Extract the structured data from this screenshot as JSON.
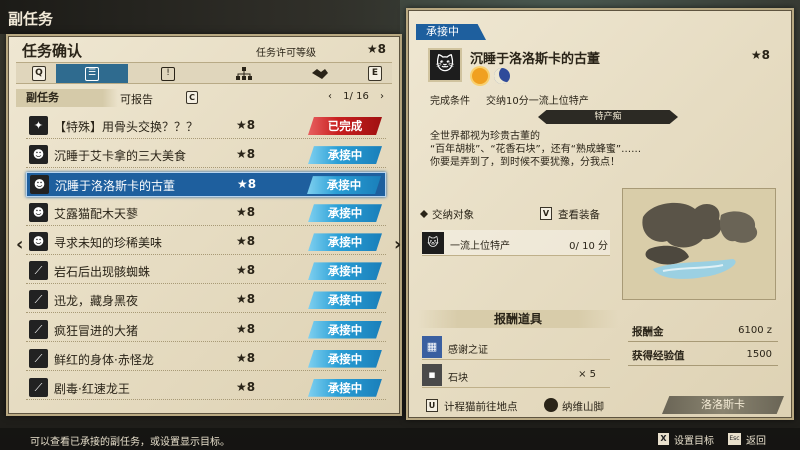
{
  "header": {
    "title": "副任务"
  },
  "left": {
    "title": "任务确认",
    "permit_label": "任务许可等级",
    "permit_level": "★8",
    "tabs": {
      "prev_key": "Q",
      "next_key": "E"
    },
    "filter": {
      "sub_label": "副任务",
      "report_label": "可报告",
      "report_key": "C",
      "prev": "‹",
      "page": "1/ 16",
      "next": "›"
    },
    "nav": {
      "left": "‹",
      "right": "›"
    },
    "quests": [
      {
        "icon": "bone-icon",
        "name": "【特殊】用骨头交换？？？",
        "star": "★8",
        "status": "已完成",
        "type": "done"
      },
      {
        "icon": "cat-icon",
        "name": "沉睡于艾卡拿的三大美食",
        "star": "★8",
        "status": "承接中",
        "type": "accept"
      },
      {
        "icon": "cat-icon",
        "name": "沉睡于洛洛斯卡的古董",
        "star": "★8",
        "status": "承接中",
        "type": "accept",
        "selected": true
      },
      {
        "icon": "cat-icon",
        "name": "艾露猫配木天蓼",
        "star": "★8",
        "status": "承接中",
        "type": "accept"
      },
      {
        "icon": "cat-icon",
        "name": "寻求未知的珍稀美味",
        "star": "★8",
        "status": "承接中",
        "type": "accept"
      },
      {
        "icon": "claw-icon",
        "name": "岩石后出现骸蜘蛛",
        "star": "★8",
        "status": "承接中",
        "type": "accept"
      },
      {
        "icon": "claw-icon",
        "name": "迅龙，藏身黑夜",
        "star": "★8",
        "status": "承接中",
        "type": "accept"
      },
      {
        "icon": "claw-icon",
        "name": "疯狂冒进的大猪",
        "star": "★8",
        "status": "承接中",
        "type": "accept"
      },
      {
        "icon": "claw-icon",
        "name": "鲜红的身体·赤怪龙",
        "star": "★8",
        "status": "承接中",
        "type": "accept"
      },
      {
        "icon": "claw-icon",
        "name": "剧毒·红速龙王",
        "star": "★8",
        "status": "承接中",
        "type": "accept"
      }
    ]
  },
  "right": {
    "badge": "承接中",
    "quest_name": "沉睡于洛洛斯卡的古董",
    "quest_star": "★8",
    "time_icons": [
      "sun-icon",
      "moon-icon"
    ],
    "condition_label": "完成条件",
    "condition_value": "交纳10分一流上位特产",
    "ribbon": "特产痴",
    "description": [
      "全世界都视为珍贵古董的",
      "“百年胡桃”、“花香石块”，还有“熟成蜂蜜”……",
      "你要是弄到了，到时候不要犹豫，分我点！"
    ],
    "target_label": "交纳对象",
    "view_key": "V",
    "view_label": "查看装备",
    "target_name": "一流上位特产",
    "target_count": "0/ 10 分",
    "reward_title": "报酬道具",
    "rewards": [
      {
        "icon": "certificate-icon",
        "name": "感谢之证",
        "qty": ""
      },
      {
        "icon": "stone-icon",
        "name": "石块",
        "qty": "× 5"
      }
    ],
    "money_label": "报酬金",
    "money_value": "6100 z",
    "exp_label": "获得经验值",
    "exp_value": "1500",
    "travel_key": "U",
    "travel_label": "计程猫前往地点",
    "travel_location": "纳维山脚",
    "travel_button": "洛洛斯卡"
  },
  "footer": {
    "hint": "可以查看已承接的副任务，或设置显示目标。",
    "set_key": "X",
    "set_label": "设置目标",
    "back_key": "Esc",
    "back_label": "返回"
  },
  "colors": {
    "accept": "#2a9fd6",
    "done": "#c82020",
    "selected": "#1e5f9e"
  }
}
